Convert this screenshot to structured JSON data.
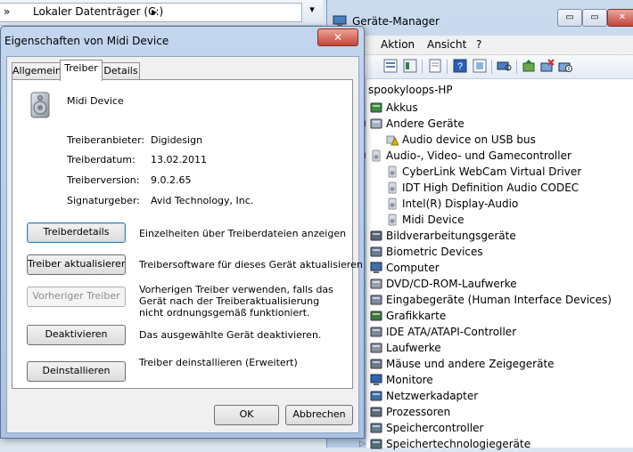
{
  "explorer": {
    "address_sep": "»",
    "address_drive": "Lokaler Datenträger (C:)",
    "address_arrow": "▸",
    "scroll_glyph": "▾"
  },
  "device_manager": {
    "title": "Geräte-Manager",
    "window_buttons": {
      "min": "▭",
      "max": "▭",
      "close": "✕"
    },
    "menu": [
      "Aktion",
      "Ansicht",
      "?"
    ],
    "tree": {
      "root": "spookyloops-HP",
      "nodes": [
        {
          "label": "Akkus",
          "icon": "battery-icon",
          "level": 1,
          "expanded": false
        },
        {
          "label": "Andere Geräte",
          "icon": "unknown-device-icon",
          "level": 1,
          "expanded": true
        },
        {
          "label": "Audio device on USB bus",
          "icon": "warning-device-icon",
          "level": 2
        },
        {
          "label": "Audio-, Video- und Gamecontroller",
          "icon": "speaker-icon",
          "level": 1,
          "expanded": true
        },
        {
          "label": "CyberLink WebCam Virtual Driver",
          "icon": "speaker-icon",
          "level": 2
        },
        {
          "label": "IDT High Definition Audio CODEC",
          "icon": "speaker-icon",
          "level": 2
        },
        {
          "label": "Intel(R) Display-Audio",
          "icon": "speaker-icon",
          "level": 2
        },
        {
          "label": "Midi Device",
          "icon": "speaker-icon",
          "level": 2
        },
        {
          "label": "Bildverarbeitungsgeräte",
          "icon": "camera-icon",
          "level": 1,
          "expanded": false
        },
        {
          "label": "Biometric Devices",
          "icon": "biometric-icon",
          "level": 1,
          "expanded": false
        },
        {
          "label": "Computer",
          "icon": "computer-icon",
          "level": 1,
          "expanded": false
        },
        {
          "label": "DVD/CD-ROM-Laufwerke",
          "icon": "disc-drive-icon",
          "level": 1,
          "expanded": false
        },
        {
          "label": "Eingabegeräte (Human Interface Devices)",
          "icon": "hid-icon",
          "level": 1,
          "expanded": false
        },
        {
          "label": "Grafikkarte",
          "icon": "display-adapter-icon",
          "level": 1,
          "expanded": false
        },
        {
          "label": "IDE ATA/ATAPI-Controller",
          "icon": "ide-controller-icon",
          "level": 1,
          "expanded": false
        },
        {
          "label": "Laufwerke",
          "icon": "disk-drive-icon",
          "level": 1,
          "expanded": false
        },
        {
          "label": "Mäuse und andere Zeigegeräte",
          "icon": "mouse-icon",
          "level": 1,
          "expanded": false
        },
        {
          "label": "Monitore",
          "icon": "monitor-icon",
          "level": 1,
          "expanded": false
        },
        {
          "label": "Netzwerkadapter",
          "icon": "network-adapter-icon",
          "level": 1,
          "expanded": false
        },
        {
          "label": "Prozessoren",
          "icon": "processor-icon",
          "level": 1,
          "expanded": false
        },
        {
          "label": "Speichercontroller",
          "icon": "storage-controller-icon",
          "level": 1,
          "expanded": false
        },
        {
          "label": "Speichertechnologiegeräte",
          "icon": "storage-technology-icon",
          "level": 1,
          "expanded": false
        }
      ]
    }
  },
  "properties_dialog": {
    "title": "Eigenschaften von Midi Device",
    "close_label": "✕",
    "tabs": [
      {
        "label": "Allgemein",
        "active": false
      },
      {
        "label": "Treiber",
        "active": true
      },
      {
        "label": "Details",
        "active": false
      }
    ],
    "device_name": "Midi Device",
    "driver_info": [
      {
        "label": "Treiberanbieter:",
        "value": "Digidesign"
      },
      {
        "label": "Treiberdatum:",
        "value": "13.02.2011"
      },
      {
        "label": "Treiberversion:",
        "value": "9.0.2.65"
      },
      {
        "label": "Signaturgeber:",
        "value": "Avid Technology, Inc."
      }
    ],
    "actions": [
      {
        "button": "Treiberdetails",
        "description": "Einzelheiten über Treiberdateien anzeigen",
        "enabled": true
      },
      {
        "button": "Treiber aktualisieren...",
        "description": "Treibersoftware für dieses Gerät aktualisieren",
        "enabled": true
      },
      {
        "button": "Vorheriger Treiber",
        "description": "Vorherigen Treiber verwenden, falls das Gerät nach der Treiberaktualisierung nicht ordnungsgemäß funktioniert.",
        "enabled": false
      },
      {
        "button": "Deaktivieren",
        "description": "Das ausgewählte Gerät deaktivieren.",
        "enabled": true
      },
      {
        "button": "Deinstallieren",
        "description": "Treiber deinstallieren (Erweitert)",
        "enabled": true
      }
    ],
    "ok_label": "OK",
    "cancel_label": "Abbrechen"
  }
}
